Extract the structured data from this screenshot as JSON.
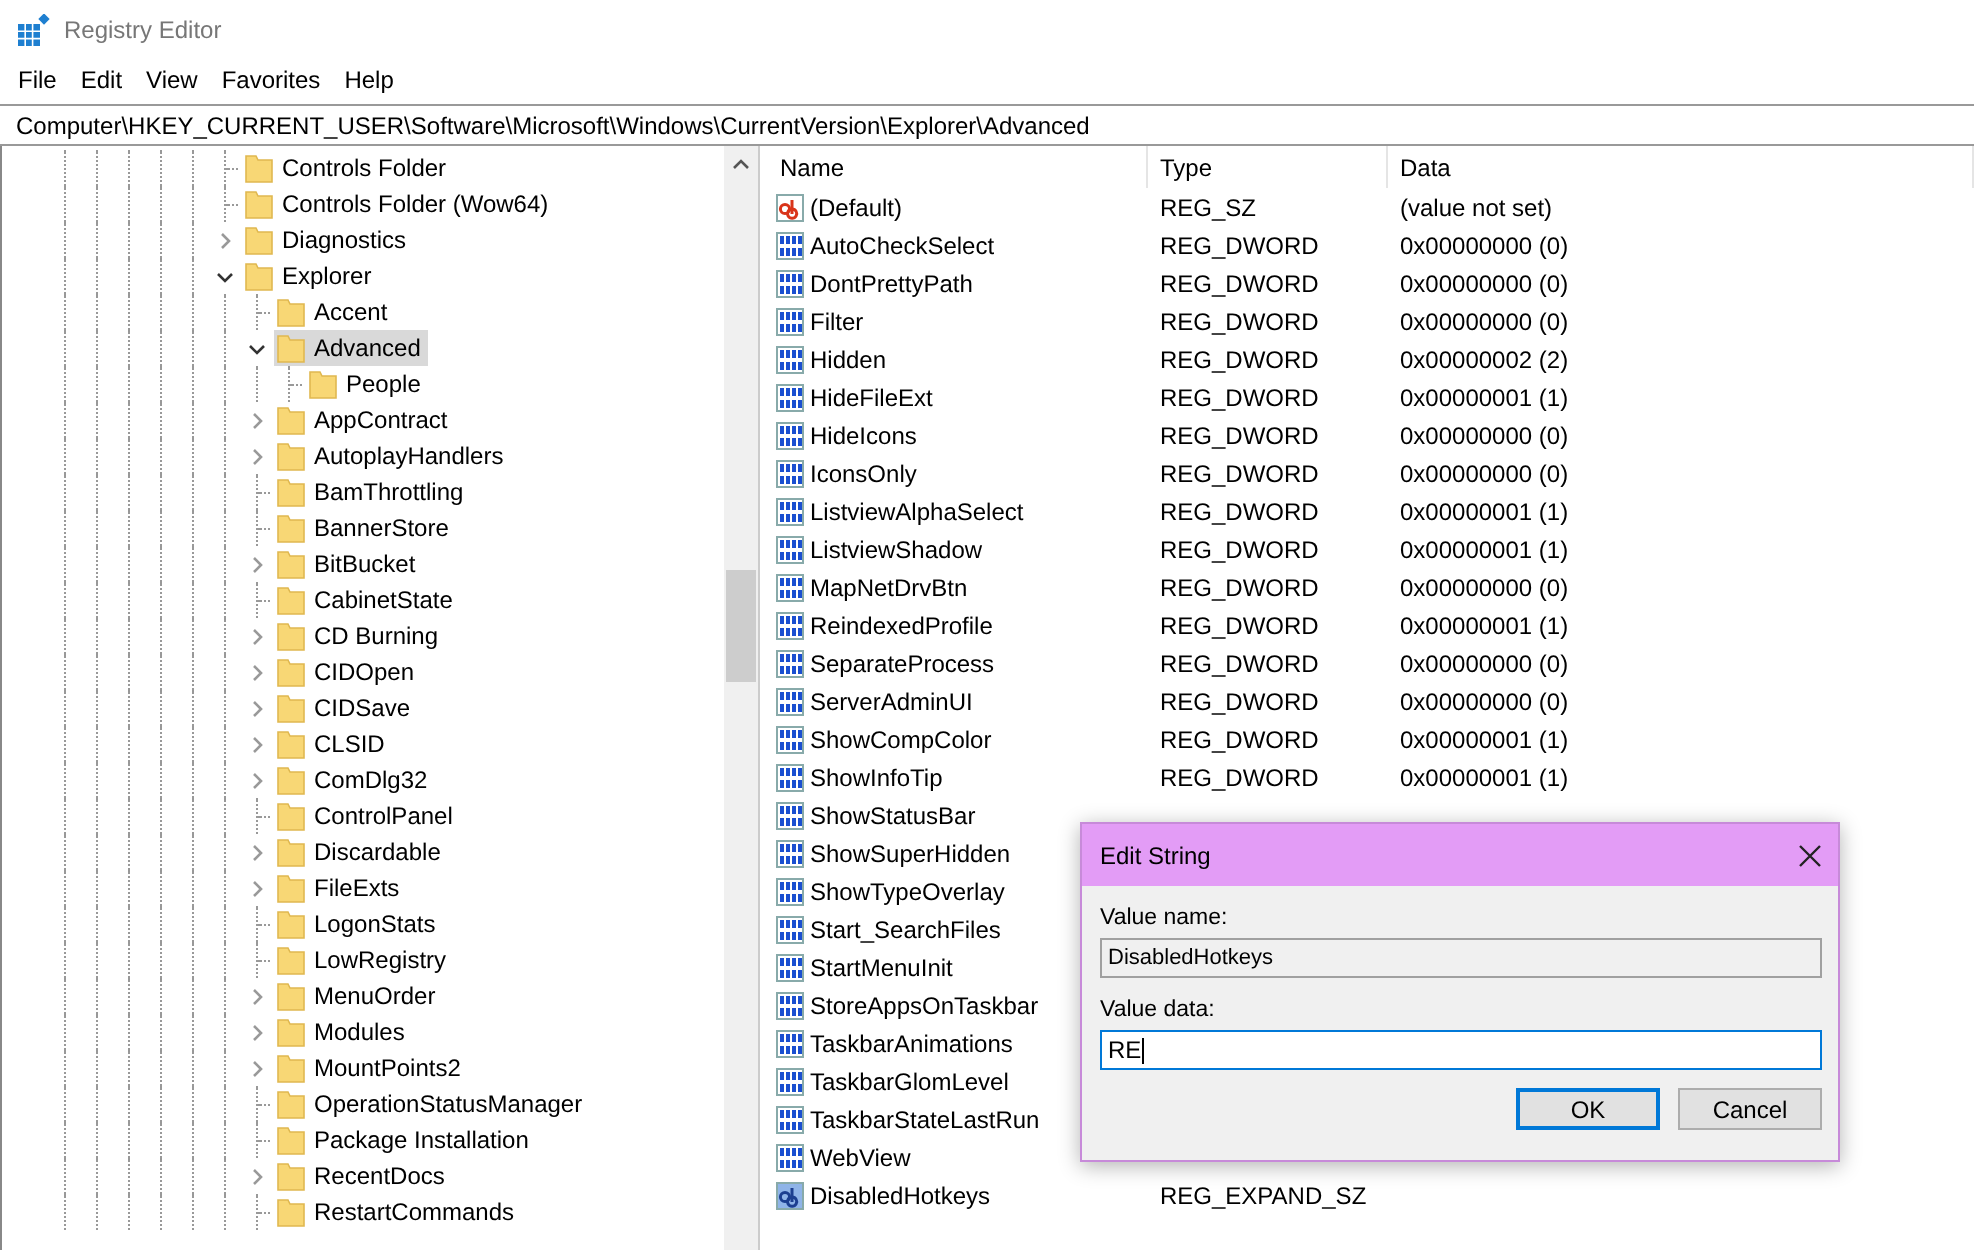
{
  "window": {
    "title": "Registry Editor"
  },
  "menu": [
    "File",
    "Edit",
    "View",
    "Favorites",
    "Help"
  ],
  "address": "Computer\\HKEY_CURRENT_USER\\Software\\Microsoft\\Windows\\CurrentVersion\\Explorer\\Advanced",
  "tree": [
    {
      "label": "Controls Folder",
      "kind": "leaf",
      "selected": false
    },
    {
      "label": "Controls Folder (Wow64)",
      "kind": "leaf",
      "selected": false
    },
    {
      "label": "Diagnostics",
      "kind": "collapsed",
      "selected": false
    },
    {
      "label": "Explorer",
      "kind": "expanded",
      "selected": false,
      "children": [
        {
          "label": "Accent",
          "kind": "leaf",
          "selected": false
        },
        {
          "label": "Advanced",
          "kind": "expanded",
          "selected": true,
          "children": [
            {
              "label": "People",
              "kind": "leaf",
              "selected": false
            }
          ]
        },
        {
          "label": "AppContract",
          "kind": "collapsed",
          "selected": false
        },
        {
          "label": "AutoplayHandlers",
          "kind": "collapsed",
          "selected": false
        },
        {
          "label": "BamThrottling",
          "kind": "leaf",
          "selected": false
        },
        {
          "label": "BannerStore",
          "kind": "leaf",
          "selected": false
        },
        {
          "label": "BitBucket",
          "kind": "collapsed",
          "selected": false
        },
        {
          "label": "CabinetState",
          "kind": "leaf",
          "selected": false
        },
        {
          "label": "CD Burning",
          "kind": "collapsed",
          "selected": false
        },
        {
          "label": "CIDOpen",
          "kind": "collapsed",
          "selected": false
        },
        {
          "label": "CIDSave",
          "kind": "collapsed",
          "selected": false
        },
        {
          "label": "CLSID",
          "kind": "collapsed",
          "selected": false
        },
        {
          "label": "ComDlg32",
          "kind": "collapsed",
          "selected": false
        },
        {
          "label": "ControlPanel",
          "kind": "leaf",
          "selected": false
        },
        {
          "label": "Discardable",
          "kind": "collapsed",
          "selected": false
        },
        {
          "label": "FileExts",
          "kind": "collapsed",
          "selected": false
        },
        {
          "label": "LogonStats",
          "kind": "leaf",
          "selected": false
        },
        {
          "label": "LowRegistry",
          "kind": "leaf",
          "selected": false
        },
        {
          "label": "MenuOrder",
          "kind": "collapsed",
          "selected": false
        },
        {
          "label": "Modules",
          "kind": "collapsed",
          "selected": false
        },
        {
          "label": "MountPoints2",
          "kind": "collapsed",
          "selected": false
        },
        {
          "label": "OperationStatusManager",
          "kind": "leaf",
          "selected": false
        },
        {
          "label": "Package Installation",
          "kind": "leaf",
          "selected": false
        },
        {
          "label": "RecentDocs",
          "kind": "collapsed",
          "selected": false
        },
        {
          "label": "RestartCommands",
          "kind": "leaf",
          "selected": false
        }
      ]
    }
  ],
  "columns": [
    "Name",
    "Type",
    "Data"
  ],
  "values": [
    {
      "kind": "string",
      "name": "(Default)",
      "type": "REG_SZ",
      "data": "(value not set)"
    },
    {
      "kind": "binary",
      "name": "AutoCheckSelect",
      "type": "REG_DWORD",
      "data": "0x00000000 (0)"
    },
    {
      "kind": "binary",
      "name": "DontPrettyPath",
      "type": "REG_DWORD",
      "data": "0x00000000 (0)"
    },
    {
      "kind": "binary",
      "name": "Filter",
      "type": "REG_DWORD",
      "data": "0x00000000 (0)"
    },
    {
      "kind": "binary",
      "name": "Hidden",
      "type": "REG_DWORD",
      "data": "0x00000002 (2)"
    },
    {
      "kind": "binary",
      "name": "HideFileExt",
      "type": "REG_DWORD",
      "data": "0x00000001 (1)"
    },
    {
      "kind": "binary",
      "name": "HideIcons",
      "type": "REG_DWORD",
      "data": "0x00000000 (0)"
    },
    {
      "kind": "binary",
      "name": "IconsOnly",
      "type": "REG_DWORD",
      "data": "0x00000000 (0)"
    },
    {
      "kind": "binary",
      "name": "ListviewAlphaSelect",
      "type": "REG_DWORD",
      "data": "0x00000001 (1)"
    },
    {
      "kind": "binary",
      "name": "ListviewShadow",
      "type": "REG_DWORD",
      "data": "0x00000001 (1)"
    },
    {
      "kind": "binary",
      "name": "MapNetDrvBtn",
      "type": "REG_DWORD",
      "data": "0x00000000 (0)"
    },
    {
      "kind": "binary",
      "name": "ReindexedProfile",
      "type": "REG_DWORD",
      "data": "0x00000001 (1)"
    },
    {
      "kind": "binary",
      "name": "SeparateProcess",
      "type": "REG_DWORD",
      "data": "0x00000000 (0)"
    },
    {
      "kind": "binary",
      "name": "ServerAdminUI",
      "type": "REG_DWORD",
      "data": "0x00000000 (0)"
    },
    {
      "kind": "binary",
      "name": "ShowCompColor",
      "type": "REG_DWORD",
      "data": "0x00000001 (1)"
    },
    {
      "kind": "binary",
      "name": "ShowInfoTip",
      "type": "REG_DWORD",
      "data": "0x00000001 (1)"
    },
    {
      "kind": "binary",
      "name": "ShowStatusBar"
    },
    {
      "kind": "binary",
      "name": "ShowSuperHidden"
    },
    {
      "kind": "binary",
      "name": "ShowTypeOverlay"
    },
    {
      "kind": "binary",
      "name": "Start_SearchFiles"
    },
    {
      "kind": "binary",
      "name": "StartMenuInit"
    },
    {
      "kind": "binary",
      "name": "StoreAppsOnTaskbar"
    },
    {
      "kind": "binary",
      "name": "TaskbarAnimations"
    },
    {
      "kind": "binary",
      "name": "TaskbarGlomLevel"
    },
    {
      "kind": "binary",
      "name": "TaskbarStateLastRun"
    },
    {
      "kind": "binary",
      "name": "WebView"
    },
    {
      "kind": "expand_string",
      "name": "DisabledHotkeys",
      "type": "REG_EXPAND_SZ"
    }
  ],
  "dialog": {
    "title": "Edit String",
    "name_label": "Value name:",
    "name_value": "DisabledHotkeys",
    "data_label": "Value data:",
    "data_value": "RE",
    "buttons": [
      {
        "label": "OK",
        "default": true
      },
      {
        "label": "Cancel",
        "default": false
      }
    ]
  }
}
